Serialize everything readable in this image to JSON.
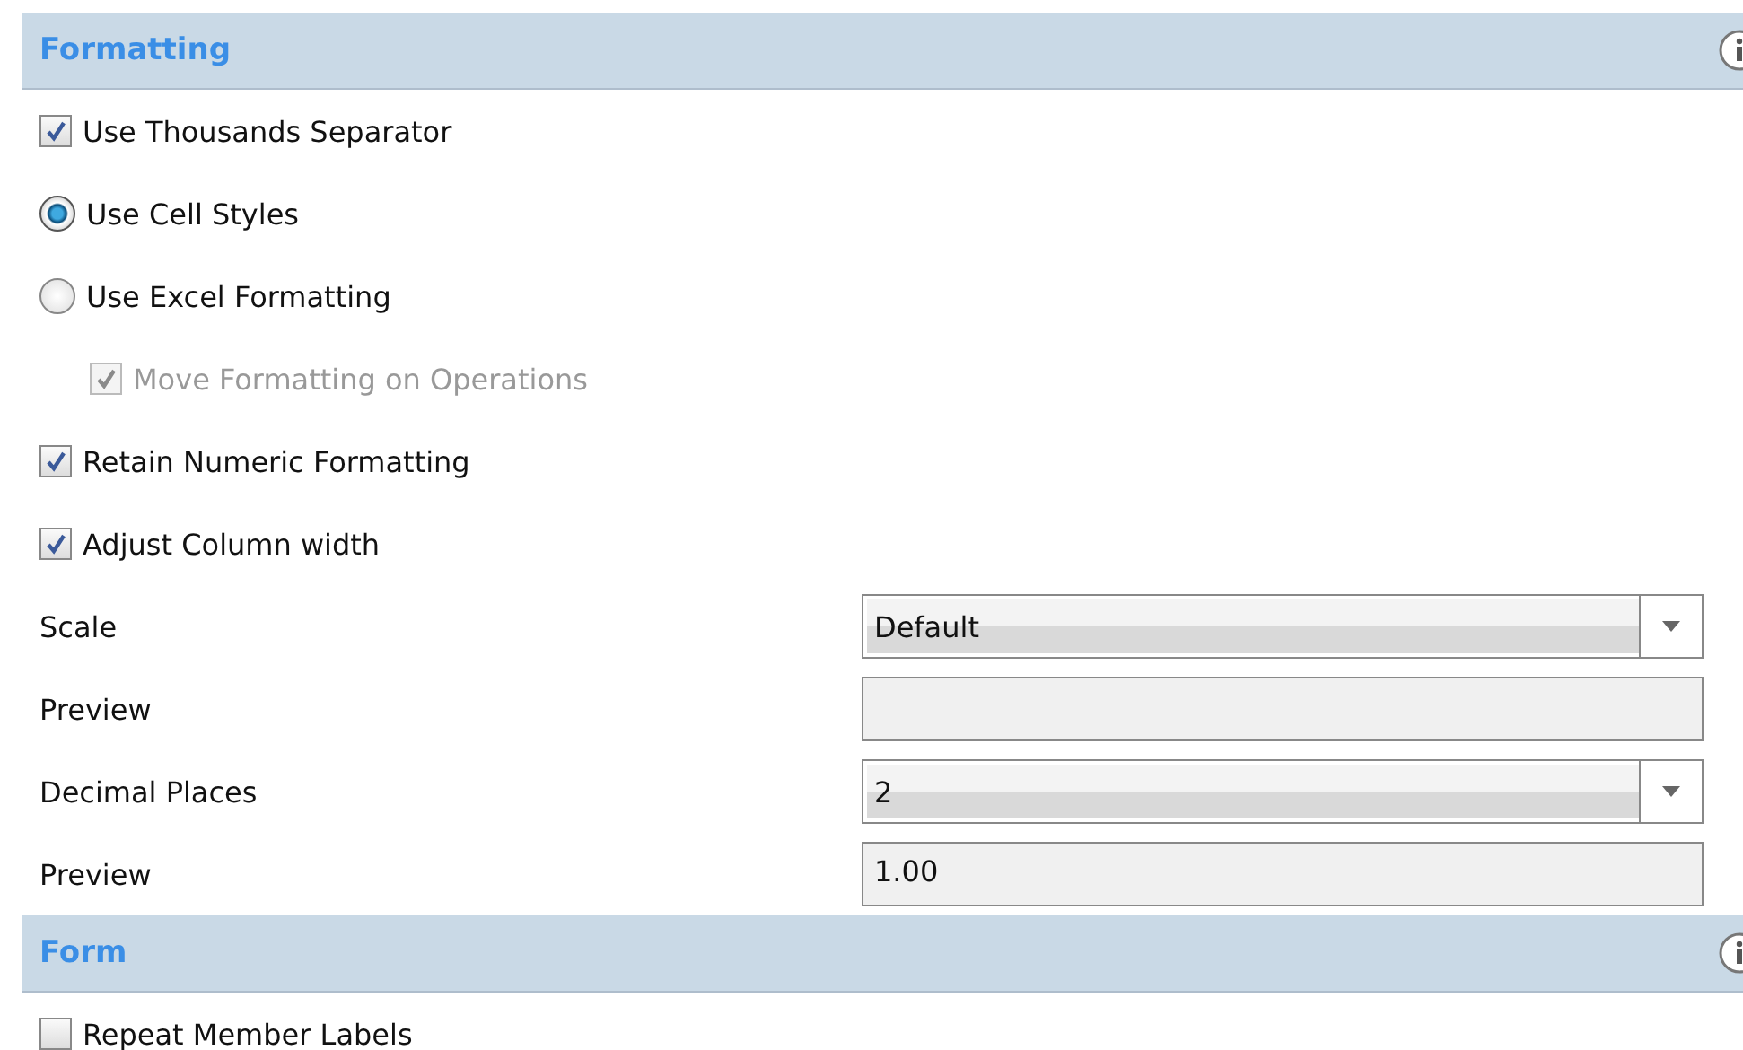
{
  "sections": [
    {
      "title": "Formatting",
      "items": [
        {
          "kind": "checkbox",
          "label": "Use Thousands Separator",
          "checked": true,
          "disabled": false
        },
        {
          "kind": "radio",
          "label": "Use Cell Styles",
          "selected": true
        },
        {
          "kind": "radio",
          "label": "Use Excel Formatting",
          "selected": false,
          "children": [
            {
              "kind": "checkbox",
              "label": "Move Formatting on Operations",
              "checked": true,
              "disabled": true
            }
          ]
        },
        {
          "kind": "checkbox",
          "label": "Retain Numeric Formatting",
          "checked": true,
          "disabled": false
        },
        {
          "kind": "checkbox",
          "label": "Adjust Column width",
          "checked": true,
          "disabled": false
        },
        {
          "kind": "dropdown",
          "label": "Scale",
          "value": "Default"
        },
        {
          "kind": "text",
          "label": "Preview"
        },
        {
          "kind": "dropdown",
          "label": "Decimal Places",
          "value": "2"
        },
        {
          "kind": "text",
          "label": "Preview",
          "value": "1.00"
        }
      ]
    },
    {
      "title": "Form",
      "items": [
        {
          "kind": "checkbox",
          "label": "Repeat Member Labels",
          "checked": false,
          "disabled": false
        }
      ]
    }
  ]
}
